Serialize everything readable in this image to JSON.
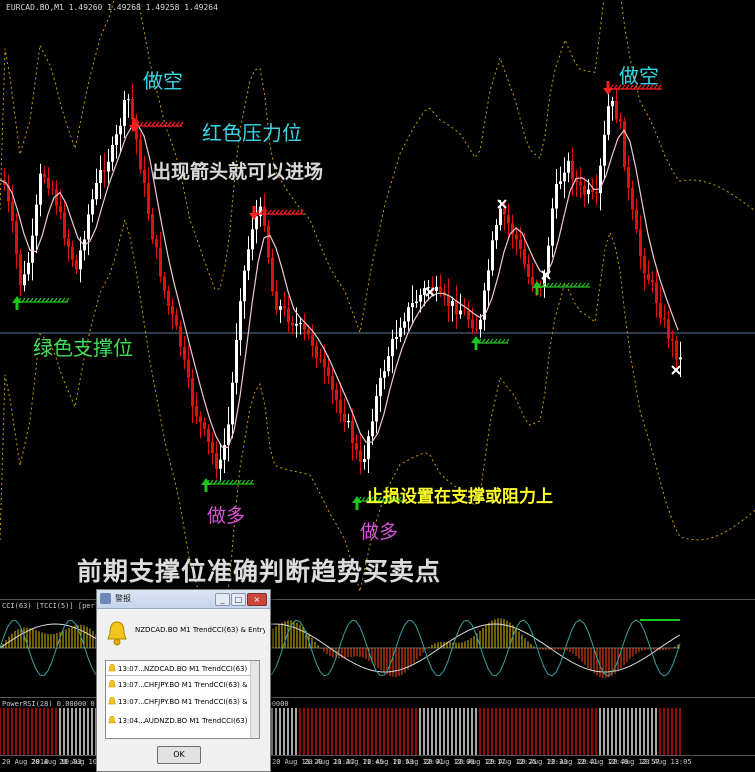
{
  "chart": {
    "symbol_info": "EURCAD.BO,M1  1.49260 1.49268 1.49258 1.49264",
    "price_line_label": ""
  },
  "annotations": {
    "short_1": "做空",
    "short_2": "做空",
    "red_resistance": "红色压力位",
    "arrow_entry": "出现箭头就可以进场",
    "green_support": "绿色支撑位",
    "long_1": "做多",
    "long_2": "做多",
    "stop_loss": "止损设置在支撑或阻力上",
    "summary": "前期支撑位准确判断趋势买卖点"
  },
  "indicator1": {
    "label": "CCI(63) [TCCI(5)] [per EMA: 60]   -93.679"
  },
  "indicator2": {
    "label": "PowerRSI(28)  0.00000 0.00000 0.00000 0.00000 0.00000 0.00000 0.00000"
  },
  "time_axis": {
    "ticks": [
      "20 Aug 2018",
      "20 Aug 10:33",
      "20 Aug 10:41",
      "20 Aug 11:29",
      "20 Aug 11:37",
      "20 Aug 11:45",
      "20 Aug 11:53",
      "20 Aug 12:01",
      "20 Aug 12:09",
      "20 Aug 12:17",
      "20 Aug 12:25",
      "20 Aug 12:33",
      "20 Aug 12:41",
      "20 Aug 12:49",
      "20 Aug 12:57",
      "20 Aug 13:05"
    ]
  },
  "alert_dialog": {
    "title": "警报",
    "message": "NZDCAD.BO M1 TrendCCI(63) & EntryCCI(5) H",
    "rows": [
      {
        "time": "13:07...",
        "msg": "NZDCAD.BO M1 TrendCCI(63) & EntryCC"
      },
      {
        "time": "13:07...",
        "msg": "CHFJPY.BO M1 TrendCCI(63) & EntryCC"
      },
      {
        "time": "13:07...",
        "msg": "CHFJPY.BO M1 TrendCCI(63) & EntryCC"
      },
      {
        "time": "13:04...",
        "msg": "AUDNZD.BO M1 TrendCCI(63) & EntryCC"
      }
    ],
    "ok_label": "OK",
    "minimize": "_",
    "maximize": "□",
    "close": "×"
  }
}
